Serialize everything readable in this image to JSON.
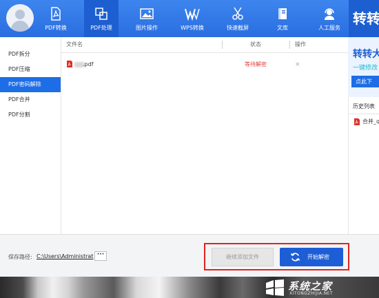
{
  "nav": {
    "items": [
      {
        "label": "PDF转换",
        "icon": "pdf-icon"
      },
      {
        "label": "PDF处理",
        "icon": "pdf-process-icon",
        "active": true
      },
      {
        "label": "图片操作",
        "icon": "image-icon"
      },
      {
        "label": "WPS转换",
        "icon": "wps-icon"
      },
      {
        "label": "快速截屏",
        "icon": "scissors-icon"
      },
      {
        "label": "文库",
        "icon": "library-icon"
      },
      {
        "label": "人工服务",
        "icon": "customer-service-icon"
      }
    ],
    "brand": "转转"
  },
  "sidebar": {
    "items": [
      {
        "label": "PDF拆分"
      },
      {
        "label": "PDF压缩"
      },
      {
        "label": "PDF密码解除",
        "active": true
      },
      {
        "label": "PDF合并"
      },
      {
        "label": "PDF分割"
      }
    ]
  },
  "table": {
    "headers": {
      "filename": "文件名",
      "status": "状态",
      "action": "操作"
    },
    "rows": [
      {
        "filename": ".pdf",
        "status": "等待解密",
        "action": "×"
      }
    ]
  },
  "ad": {
    "title": "转转大",
    "subtitle": "一键修改",
    "button": "点此下"
  },
  "history": {
    "title": "历史列表",
    "items": [
      {
        "label": "合并_q"
      }
    ]
  },
  "bottom": {
    "save_label": "保存路径:",
    "save_path": "C:\\Users\\Administrat",
    "more": "···",
    "add_button": "继续添加文件",
    "start_button": "开始解密"
  },
  "watermark": {
    "text": "系统之家",
    "url": "XITONGZHIJIA.NET"
  },
  "colors": {
    "topbar": "#2a6ee0",
    "active": "#1d6ee6",
    "status_red": "#e2413c",
    "highlight_red": "#e2221c"
  }
}
